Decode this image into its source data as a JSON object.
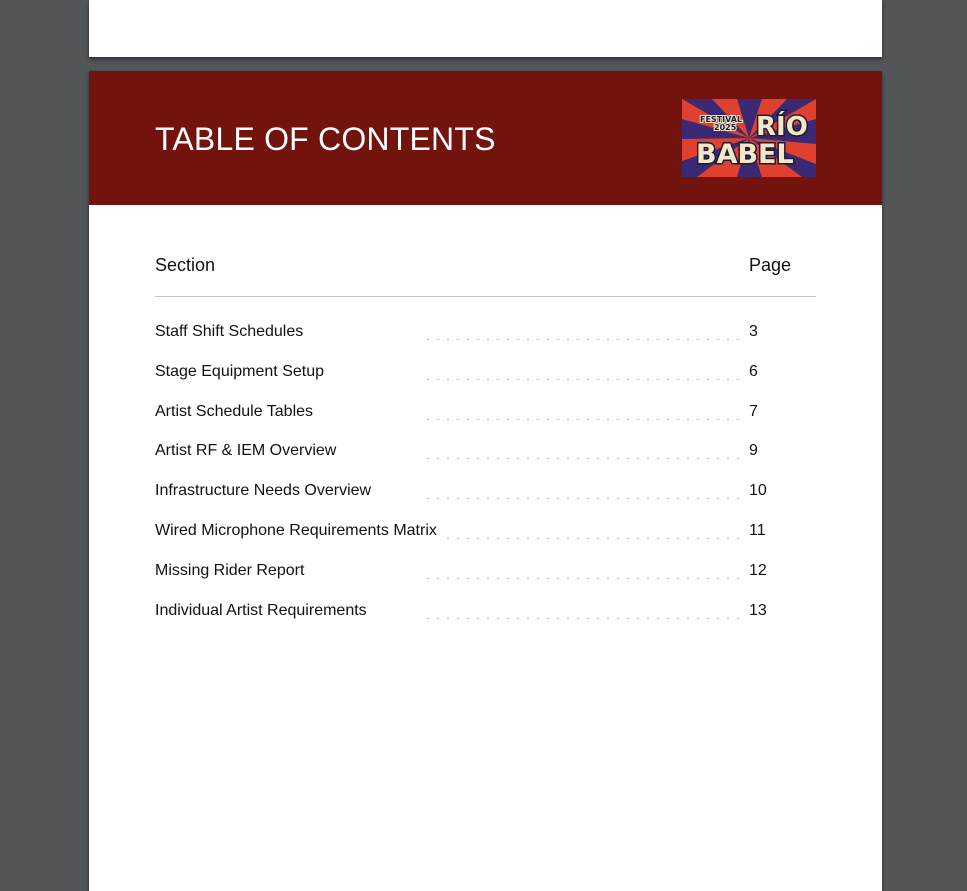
{
  "header": {
    "title": "TABLE OF CONTENTS",
    "color": "#72140d",
    "logo": {
      "festival": "FESTIVAL",
      "year": "2025",
      "word1": "RÍO",
      "word2": "BABEL"
    }
  },
  "columns": {
    "section": "Section",
    "page": "Page"
  },
  "toc": [
    {
      "title": "Staff Shift Schedules",
      "page": "3"
    },
    {
      "title": "Stage Equipment Setup",
      "page": "6"
    },
    {
      "title": "Artist Schedule Tables",
      "page": "7"
    },
    {
      "title": "Artist RF & IEM Overview",
      "page": "9"
    },
    {
      "title": "Infrastructure Needs Overview",
      "page": "10"
    },
    {
      "title": "Wired Microphone Requirements Matrix",
      "page": "11"
    },
    {
      "title": "Missing Rider Report",
      "page": "12"
    },
    {
      "title": "Individual Artist Requirements",
      "page": "13"
    }
  ]
}
